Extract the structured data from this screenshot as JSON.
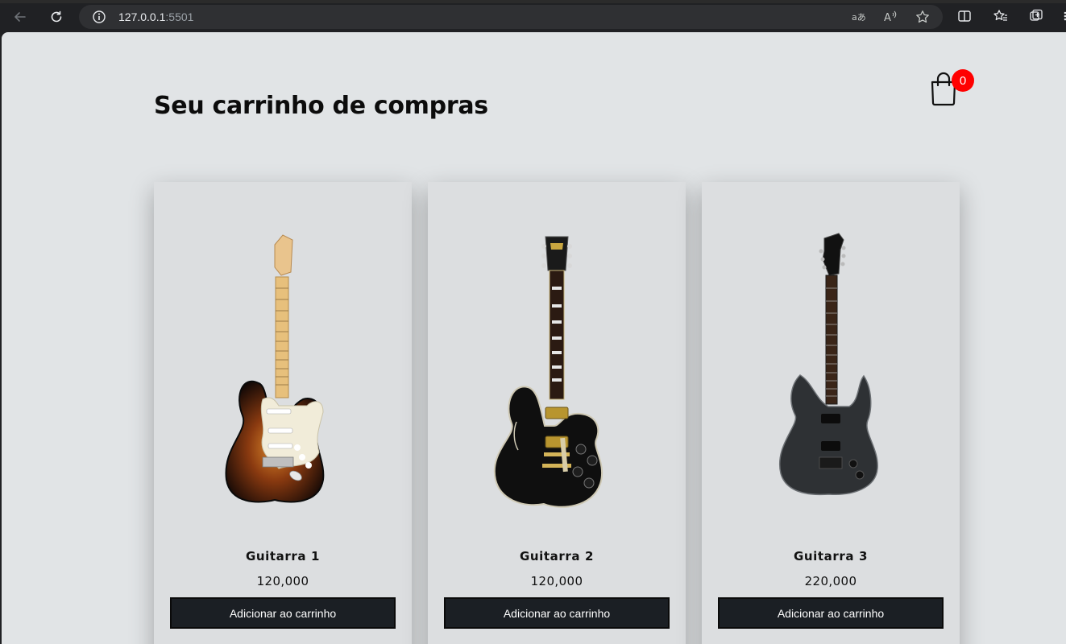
{
  "browser": {
    "url_host": "127.0.0.1",
    "url_port": ":5501",
    "icons": [
      "back-icon",
      "reload-icon",
      "info-icon",
      "translate-icon",
      "read-aloud-icon",
      "favorite-star-icon",
      "split-screen-icon",
      "favorites-icon",
      "collections-icon"
    ]
  },
  "page": {
    "title": "Seu carrinho de compras",
    "cart_count": "0"
  },
  "products": [
    {
      "name": "Guitarra 1",
      "price": "120,000",
      "button": "Adicionar ao carrinho",
      "image": "sunburst-strat-guitar",
      "color": "#3a1e0e"
    },
    {
      "name": "Guitarra 2",
      "price": "120,000",
      "button": "Adicionar ao carrinho",
      "image": "black-les-paul-guitar",
      "color": "#141414"
    },
    {
      "name": "Guitarra 3",
      "price": "220,000",
      "button": "Adicionar ao carrinho",
      "image": "black-superstrat-guitar",
      "color": "#2a2d30"
    }
  ],
  "colors": {
    "page_bg": "#e1e4e6",
    "card_bg": "#dcdee0",
    "button_bg": "#1b1f24",
    "badge_bg": "#ff0000"
  }
}
